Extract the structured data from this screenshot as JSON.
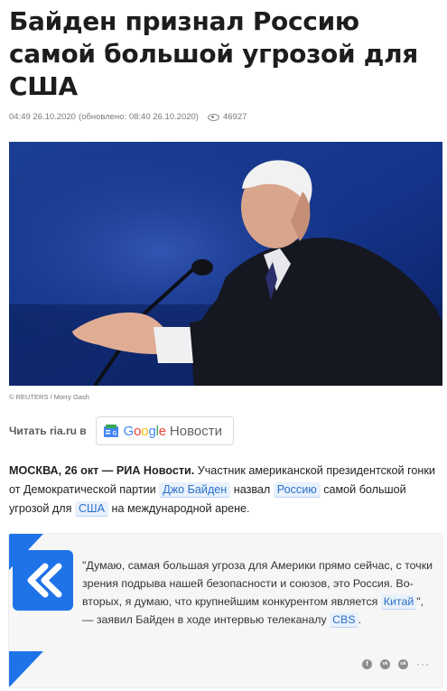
{
  "article": {
    "headline": "Байден признал Россию самой большой угрозой для США",
    "published": "04:49 26.10.2020",
    "updated": "(обновлено: 08:40 26.10.2020)",
    "views": "46927",
    "photo_credit": "© REUTERS / Morry Gash"
  },
  "read_on": {
    "label": "Читать ria.ru в",
    "google_word": [
      "G",
      "o",
      "o",
      "g",
      "l",
      "e"
    ],
    "google_colors": [
      "#4285F4",
      "#EA4335",
      "#FBBC05",
      "#4285F4",
      "#34A853",
      "#EA4335"
    ],
    "news_label": "Новости",
    "icon": "google-news-icon"
  },
  "lead": {
    "dateline": "МОСКВА, 26 окт — РИА Новости.",
    "text_1": " Участник американской президентской гонки от Демократической партии ",
    "tag_biden": "Джо Байден",
    "text_2": " назвал ",
    "tag_russia": "Россию",
    "text_3": " самой большой угрозой для ",
    "tag_usa": "США",
    "text_4": " на международной арене."
  },
  "quote": {
    "part_1": "\"Думаю, самая большая угроза для Америки прямо сейчас, с точки зрения подрыва нашей безопасности и союзов, это Россия. Во-вторых, я думаю, что крупнейшим конкурентом является ",
    "tag_china": "Китай",
    "part_2": "\", — заявил Байден в ходе интервью телеканалу ",
    "tag_cbs": "CBS",
    "part_3": "."
  },
  "share": {
    "facebook": "f",
    "vk": "vk",
    "ok": "ok",
    "more": "···"
  },
  "colors": {
    "accent": "#1f73e8",
    "tag_bg": "#e8f1fc",
    "tag_text": "#2a71c9"
  }
}
